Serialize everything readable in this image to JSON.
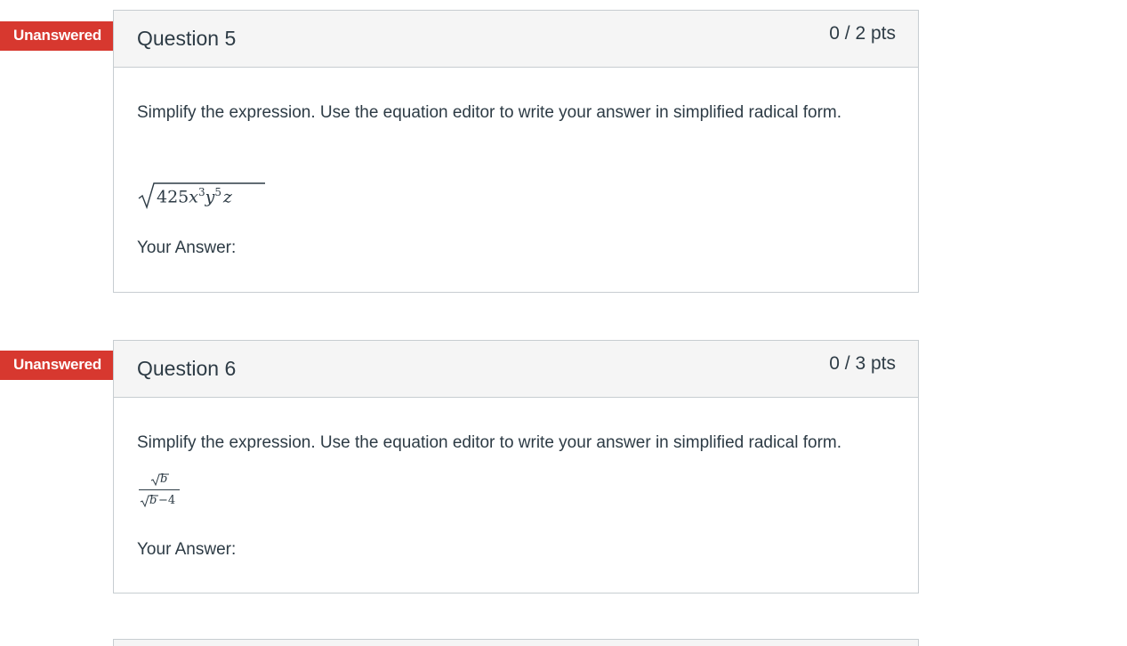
{
  "questions": [
    {
      "status_flag": "Unanswered",
      "title": "Question 5",
      "points": "0 / 2 pts",
      "prompt": "Simplify the expression. Use the equation editor to write your answer in simplified radical form.",
      "expression": {
        "radicand_coeff": "425",
        "var1": "x",
        "exp1": "3",
        "var2": "y",
        "exp2": "5",
        "var3": "z"
      },
      "answer_label": "Your Answer:"
    },
    {
      "status_flag": "Unanswered",
      "title": "Question 6",
      "points": "0 / 3 pts",
      "prompt": "Simplify the expression. Use the equation editor to write your answer in simplified radical form.",
      "expression": {
        "numerator_radicand": "b",
        "denominator_radicand": "b",
        "denominator_minus": "−4"
      },
      "answer_label": "Your Answer:"
    }
  ],
  "colors": {
    "flag": "#d7382f",
    "header_bg": "#f5f5f5",
    "border": "#c7cdd1",
    "text": "#2d3b45"
  }
}
